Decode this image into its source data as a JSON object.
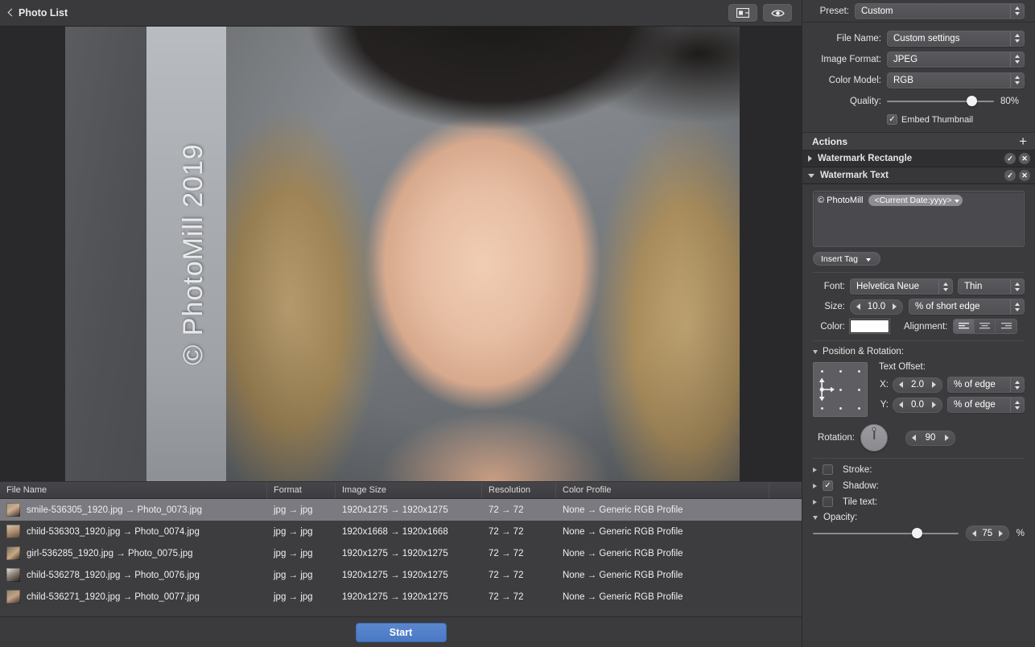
{
  "toolbar": {
    "back_label": "Photo List",
    "back_icon": "chevron-left-icon",
    "compare_icon": "split-view-icon",
    "preview_icon": "eye-icon"
  },
  "preview": {
    "watermark_text": "© PhotoMill 2019"
  },
  "table": {
    "columns": [
      "File Name",
      "Format",
      "Image Size",
      "Resolution",
      "Color Profile",
      ""
    ],
    "rows": [
      {
        "file_name": "smile-536305_1920.jpg → Photo_0073.jpg",
        "format": "jpg → jpg",
        "image_size": "1920x1275 → 1920x1275",
        "resolution": "72 → 72",
        "color_profile": "None → Generic RGB Profile",
        "selected": true
      },
      {
        "file_name": "child-536303_1920.jpg → Photo_0074.jpg",
        "format": "jpg → jpg",
        "image_size": "1920x1668 → 1920x1668",
        "resolution": "72 → 72",
        "color_profile": "None → Generic RGB Profile",
        "selected": false
      },
      {
        "file_name": "girl-536285_1920.jpg → Photo_0075.jpg",
        "format": "jpg → jpg",
        "image_size": "1920x1275 → 1920x1275",
        "resolution": "72 → 72",
        "color_profile": "None → Generic RGB Profile",
        "selected": false
      },
      {
        "file_name": "child-536278_1920.jpg → Photo_0076.jpg",
        "format": "jpg → jpg",
        "image_size": "1920x1275 → 1920x1275",
        "resolution": "72 → 72",
        "color_profile": "None → Generic RGB Profile",
        "selected": false
      },
      {
        "file_name": "child-536271_1920.jpg → Photo_0077.jpg",
        "format": "jpg → jpg",
        "image_size": "1920x1275 → 1920x1275",
        "resolution": "72 → 72",
        "color_profile": "None → Generic RGB Profile",
        "selected": false
      }
    ]
  },
  "bottom": {
    "start_label": "Start"
  },
  "panel": {
    "preset": {
      "label": "Preset:",
      "value": "Custom"
    },
    "file_name": {
      "label": "File Name:",
      "value": "Custom settings"
    },
    "image_format": {
      "label": "Image Format:",
      "value": "JPEG"
    },
    "color_model": {
      "label": "Color Model:",
      "value": "RGB"
    },
    "quality": {
      "label": "Quality:",
      "value": "80%",
      "percent": 80
    },
    "embed_thumbnail": {
      "label": "Embed Thumbnail",
      "checked": true
    },
    "actions": {
      "title": "Actions",
      "add_icon": "plus-icon",
      "items": [
        {
          "label": "Watermark Rectangle",
          "expanded": false,
          "enabled": true
        },
        {
          "label": "Watermark Text",
          "expanded": true,
          "enabled": true
        }
      ]
    },
    "watermark_text": {
      "text_value": "© PhotoMill",
      "token_label": "<Current Date:yyyy>",
      "insert_tag_label": "Insert Tag",
      "font": {
        "label": "Font:",
        "family": "Helvetica Neue",
        "weight": "Thin"
      },
      "size": {
        "label": "Size:",
        "value": "10.0",
        "unit": "% of short edge"
      },
      "color": {
        "label": "Color:",
        "hex": "#ffffff"
      },
      "alignment": {
        "label": "Alignment:",
        "options": [
          "left",
          "center",
          "right"
        ],
        "selected": "left"
      },
      "position_rotation": {
        "label": "Position & Rotation:",
        "anchor": "middle-left",
        "text_offset_label": "Text Offset:",
        "x": {
          "label": "X:",
          "value": "2.0",
          "unit": "% of edge"
        },
        "y": {
          "label": "Y:",
          "value": "0.0",
          "unit": "% of edge"
        },
        "rotation": {
          "label": "Rotation:",
          "value": "90"
        }
      },
      "stroke": {
        "label": "Stroke:",
        "checked": false
      },
      "shadow": {
        "label": "Shadow:",
        "checked": true
      },
      "tile_text": {
        "label": "Tile text:",
        "checked": false
      },
      "opacity": {
        "label": "Opacity:",
        "value": "75",
        "unit": "%",
        "percent": 75
      }
    }
  }
}
